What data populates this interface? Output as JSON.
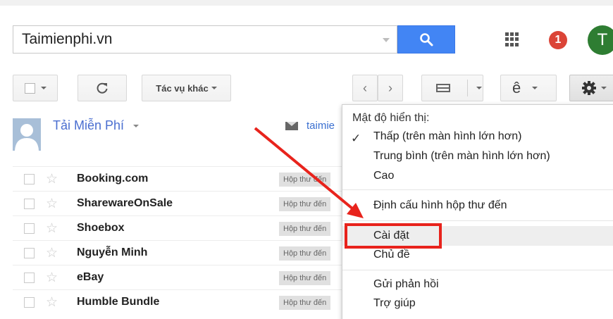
{
  "search": {
    "value": "Taimienphi.vn"
  },
  "header": {
    "notification_count": "1",
    "avatar_letter": "T"
  },
  "toolbar": {
    "refresh_icon": "refresh-icon",
    "more_actions_label": "Tác vụ khác",
    "input_tool_glyph": "ê"
  },
  "account": {
    "name": "Tải Miễn Phí",
    "primary_tab": "taimie"
  },
  "emails": [
    {
      "sender": "Booking.com",
      "label": "Hộp thư đến"
    },
    {
      "sender": "SharewareOnSale",
      "label": "Hộp thư đến"
    },
    {
      "sender": "Shoebox",
      "label": "Hộp thư đến"
    },
    {
      "sender": "Nguyễn Minh",
      "label": "Hộp thư đến"
    },
    {
      "sender": "eBay",
      "label": "Hộp thư đến"
    },
    {
      "sender": "Humble Bundle",
      "label": "Hộp thư đến"
    }
  ],
  "settings_menu": {
    "density_heading": "Mật độ hiển thị:",
    "density_options": [
      "Thấp (trên màn hình lớn hơn)",
      "Trung bình (trên màn hình lớn hơn)",
      "Cao"
    ],
    "selected_density": "Thấp (trên màn hình lớn hơn)",
    "configure_inbox": "Định cấu hình hộp thư đến",
    "settings": "Cài đặt",
    "themes": "Chủ đề",
    "feedback": "Gửi phản hồi",
    "help": "Trợ giúp"
  },
  "colors": {
    "search_button": "#4285f4",
    "badge": "#db4437",
    "avatar": "#2e7d32",
    "highlight_box": "#e8231c",
    "arrow": "#e8231c"
  }
}
